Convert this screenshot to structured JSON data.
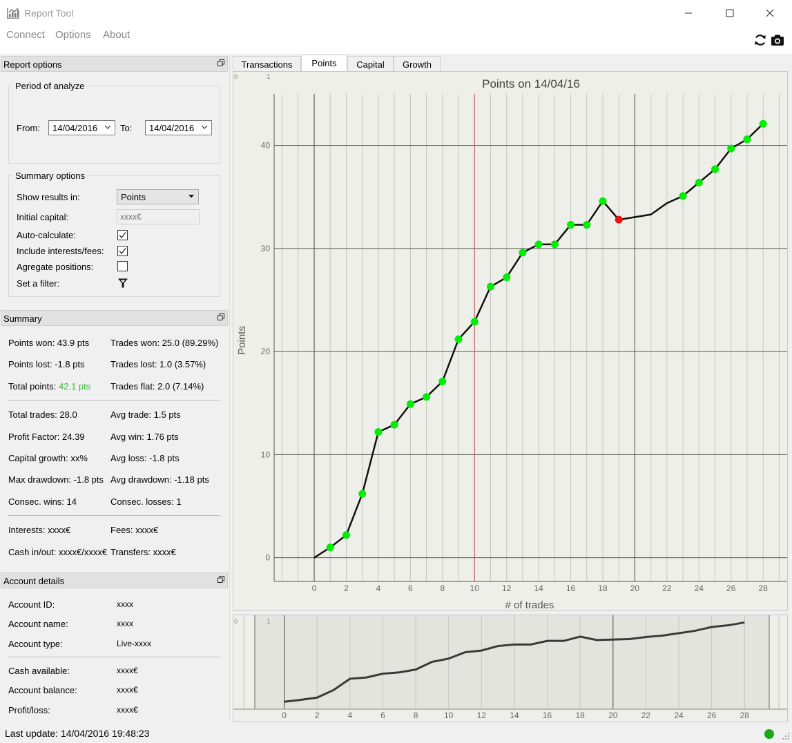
{
  "window": {
    "title": "Report Tool"
  },
  "menu": {
    "items": [
      "Connect",
      "Options",
      "About"
    ]
  },
  "report_options": {
    "header": "Report options",
    "period_title": "Period of analyze",
    "from_label": "From:",
    "from_value": "14/04/2016",
    "to_label": "To:",
    "to_value": "14/04/2016",
    "summary_title": "Summary options",
    "show_results_label": "Show results in:",
    "show_results_value": "Points",
    "initial_capital_label": "Initial capital:",
    "initial_capital_placeholder": "xxxx€",
    "auto_calculate_label": "Auto-calculate:",
    "auto_calculate_checked": true,
    "include_interests_label": "Include interests/fees:",
    "include_interests_checked": true,
    "aggregate_label": "Agregate positions:",
    "aggregate_checked": false,
    "filter_label": "Set a filter:"
  },
  "summary": {
    "header": "Summary",
    "points_won": "Points won: 43.9 pts",
    "trades_won": "Trades won: 25.0 (89.29%)",
    "points_lost": "Points lost: -1.8 pts",
    "trades_lost": "Trades lost: 1.0 (3.57%)",
    "total_points_label": "Total points: ",
    "total_points_value": "42.1 pts",
    "trades_flat": "Trades flat: 2.0 (7.14%)",
    "total_trades": "Total trades: 28.0",
    "avg_trade": "Avg trade: 1.5 pts",
    "profit_factor": "Profit Factor: 24.39",
    "avg_win": "Avg win: 1.76 pts",
    "capital_growth": "Capital growth: xx%",
    "avg_loss": "Avg loss: -1.8 pts",
    "max_drawdown": "Max drawdown: -1.8 pts",
    "avg_drawdown": "Avg drawdown: -1.18 pts",
    "consec_wins": "Consec. wins: 14",
    "consec_losses": "Consec. losses: 1",
    "interests": "Interests: xxxx€",
    "fees": "Fees: xxxx€",
    "cash_in_out": "Cash in/out: xxxx€/xxxx€",
    "transfers": "Transfers: xxxx€"
  },
  "account": {
    "header": "Account details",
    "rows": [
      {
        "label": "Account ID:",
        "value": "xxxx"
      },
      {
        "label": "Account name:",
        "value": "xxxx"
      },
      {
        "label": "Account type:",
        "value": "Live-xxxx"
      },
      {
        "label": "Cash available:",
        "value": "xxxx€"
      },
      {
        "label": "Account balance:",
        "value": "xxxx€"
      },
      {
        "label": "Profit/loss:",
        "value": "xxxx€"
      }
    ]
  },
  "tabs": [
    "Transactions",
    "Points",
    "Capital",
    "Growth"
  ],
  "active_tab": "Points",
  "status": {
    "text": "Last update: 14/04/2016 19:48:23",
    "indicator_color": "#1aa81a"
  },
  "colors": {
    "positive": "#2fbf2f",
    "point_win": "#00ee00",
    "point_loss": "#ee1111",
    "marker_line": "#c05050"
  },
  "chart_data": {
    "type": "line",
    "title": "Points on 14/04/16",
    "xlabel": "# of trades",
    "ylabel": "Points",
    "corner_labels": [
      "0",
      "1"
    ],
    "xlim": [
      -2.5,
      29.5
    ],
    "ylim": [
      -2.3,
      45
    ],
    "xticks": [
      0,
      2,
      4,
      6,
      8,
      10,
      12,
      14,
      16,
      18,
      20,
      22,
      24,
      26,
      28
    ],
    "yticks": [
      0,
      10,
      20,
      30,
      40
    ],
    "grid": true,
    "vertical_marker_x": 10,
    "x": [
      0,
      1,
      2,
      3,
      4,
      5,
      6,
      7,
      8,
      9,
      10,
      11,
      12,
      13,
      14,
      15,
      16,
      17,
      18,
      19,
      20,
      21,
      22,
      23,
      24,
      25,
      26,
      27,
      28
    ],
    "y": [
      0,
      1.0,
      2.2,
      6.2,
      12.2,
      12.9,
      14.9,
      15.6,
      17.1,
      21.2,
      22.9,
      26.3,
      27.2,
      29.6,
      30.4,
      30.4,
      32.3,
      32.3,
      34.6,
      32.8,
      null,
      33.3,
      34.4,
      35.1,
      36.4,
      37.7,
      39.7,
      40.6,
      42.1
    ],
    "point_status": [
      "none",
      "win",
      "win",
      "win",
      "win",
      "win",
      "win",
      "win",
      "win",
      "win",
      "win",
      "win",
      "win",
      "win",
      "win",
      "win",
      "win",
      "win",
      "win",
      "loss",
      "none",
      "none",
      "none",
      "win",
      "win",
      "win",
      "win",
      "win",
      "win"
    ],
    "overview_xticks": [
      0,
      2,
      4,
      6,
      8,
      10,
      12,
      14,
      16,
      18,
      20,
      22,
      24,
      26,
      28
    ]
  }
}
